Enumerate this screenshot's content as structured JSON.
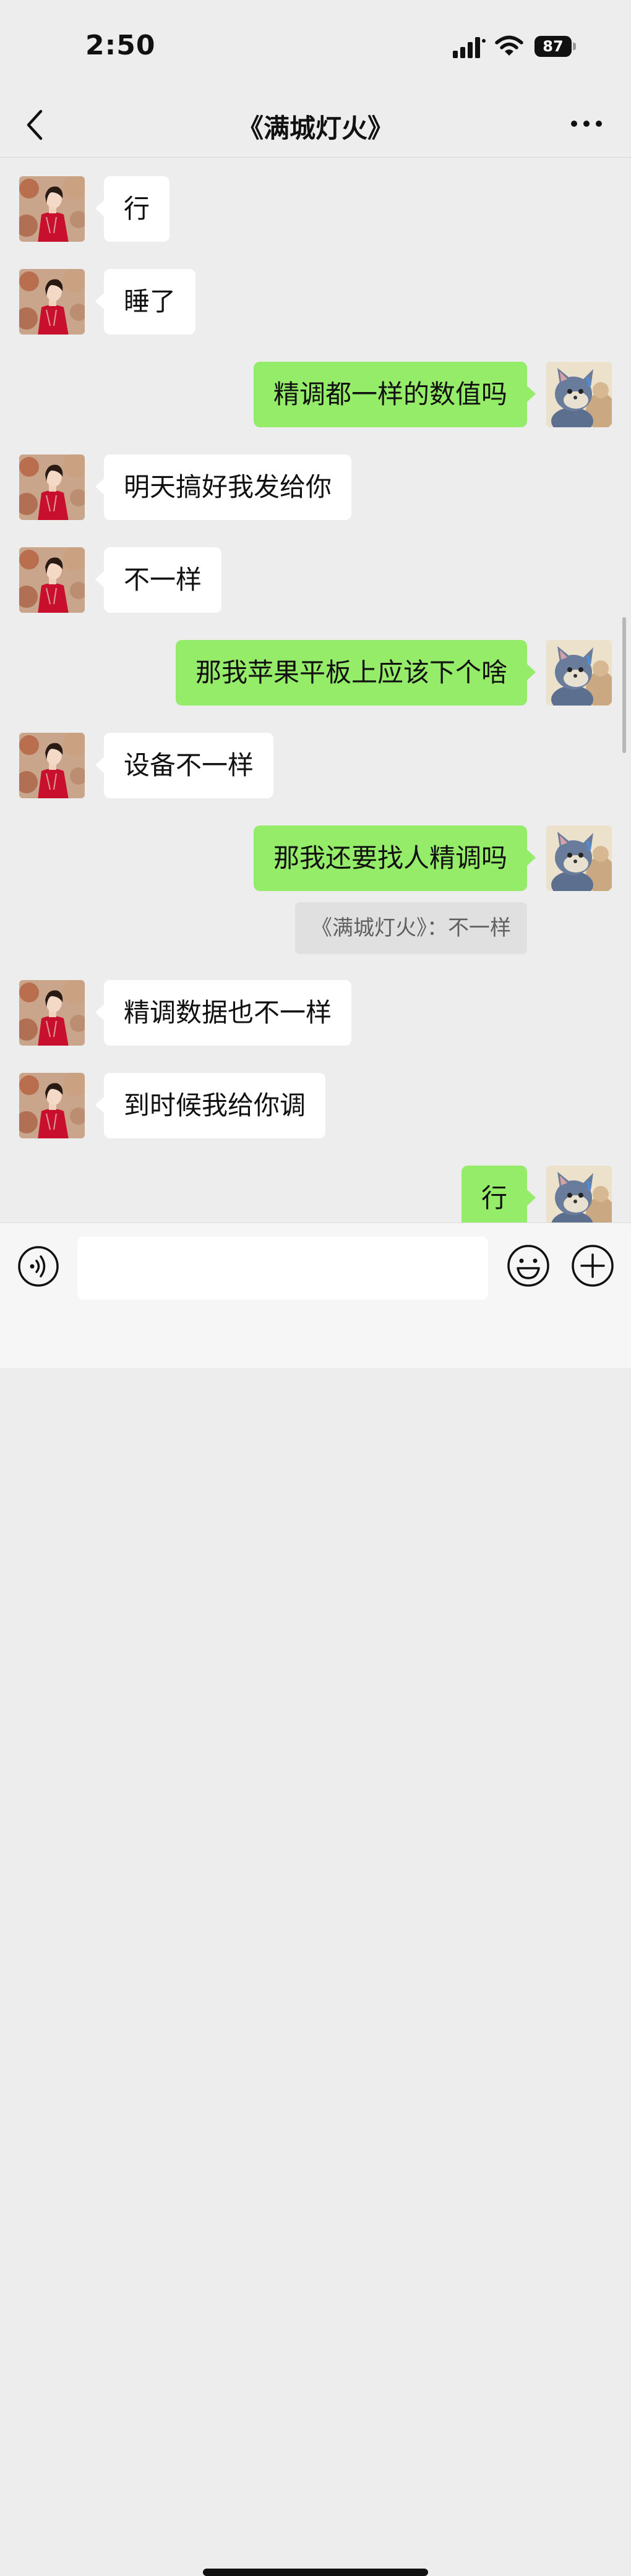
{
  "status_bar": {
    "time": "2:50",
    "battery": "87"
  },
  "nav": {
    "title": "《满城灯火》"
  },
  "messages": [
    {
      "side": "in",
      "text": "行"
    },
    {
      "side": "in",
      "text": "睡了"
    },
    {
      "side": "out",
      "text": "精调都一样的数值吗"
    },
    {
      "side": "in",
      "text": "明天搞好我发给你"
    },
    {
      "side": "in",
      "text": "不一样"
    },
    {
      "side": "out",
      "text": "那我苹果平板上应该下个啥"
    },
    {
      "side": "in",
      "text": "设备不一样"
    },
    {
      "side": "out",
      "text": "那我还要找人精调吗"
    },
    {
      "side": "in",
      "text": "精调数据也不一样"
    },
    {
      "side": "in",
      "text": "到时候我给你调"
    },
    {
      "side": "out",
      "text": "行"
    }
  ],
  "quote": {
    "text": "《满城灯火》：不一样"
  },
  "input": {
    "value": "",
    "placeholder": ""
  },
  "colors": {
    "background": "#ededed",
    "outgoing_bubble": "#95ec69",
    "incoming_bubble": "#ffffff"
  },
  "icons": {
    "back": "chevron-left-icon",
    "more": "more-dots-icon",
    "voice": "voice-icon",
    "emoji": "emoji-icon",
    "plus": "plus-icon"
  }
}
